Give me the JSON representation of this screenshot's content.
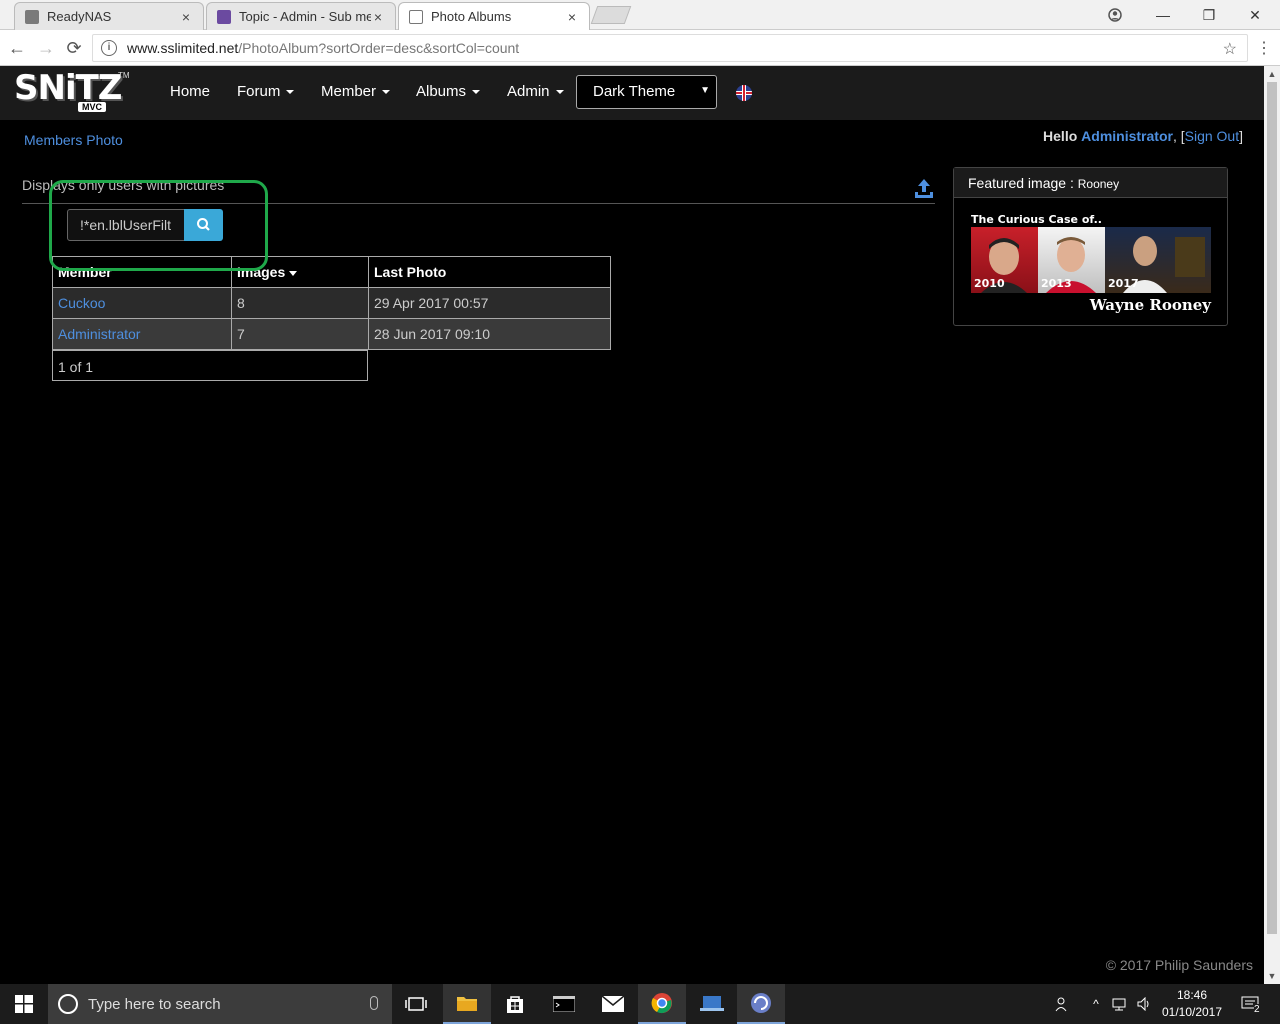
{
  "browser": {
    "tabs": [
      {
        "title": "ReadyNAS",
        "close": "×"
      },
      {
        "title": "Topic - Admin - Sub men",
        "close": "×"
      },
      {
        "title": "Photo Albums",
        "close": "×"
      }
    ],
    "window_controls": {
      "minimize": "—",
      "restore": "❐",
      "close": "✕"
    },
    "url_host": "www.sslimited.net",
    "url_path": "/PhotoAlbum?sortOrder=desc&sortCol=count",
    "back": "←",
    "forward": "→",
    "reload": "⟳",
    "star": "☆",
    "menu": "⋮"
  },
  "navbar": {
    "logo_text": "SNiTZ",
    "logo_sub": "MVC",
    "logo_tm": "TM",
    "items": [
      {
        "label": "Home",
        "dropdown": false
      },
      {
        "label": "Forum",
        "dropdown": true
      },
      {
        "label": "Member",
        "dropdown": true
      },
      {
        "label": "Albums",
        "dropdown": true
      },
      {
        "label": "Admin",
        "dropdown": true
      }
    ],
    "theme_select": "Dark Theme",
    "language_flag": "uk-flag-icon"
  },
  "header": {
    "page_link": "Members Photo",
    "hello": "Hello",
    "user": "Administrator",
    "sign_out": "Sign Out"
  },
  "main": {
    "note": "Displays only users with pictures",
    "search_value": "!*en.lblUserFilt",
    "table": {
      "columns": [
        "Member",
        "Images",
        "Last Photo"
      ],
      "sorted_column": "Images",
      "rows": [
        {
          "member": "Cuckoo",
          "images": "8",
          "last_photo": "29 Apr 2017 00:57"
        },
        {
          "member": "Administrator",
          "images": "7",
          "last_photo": "28 Jun 2017 09:10"
        }
      ],
      "pager": "1 of 1"
    }
  },
  "featured": {
    "label": "Featured image :",
    "caption": "Rooney",
    "image_title": "The Curious Case of..",
    "years": [
      "2010",
      "2013",
      "2017"
    ],
    "image_name": "Wayne Rooney"
  },
  "footer": {
    "copyright": "© 2017 Philip Saunders"
  },
  "taskbar": {
    "search_placeholder": "Type here to search",
    "time": "18:46",
    "date": "01/10/2017",
    "notifications": "2"
  },
  "colors": {
    "link": "#4e8fdf",
    "highlight_box": "#1fa84a",
    "search_button": "#3aa8d8",
    "navbar_bg": "#1b1b1b"
  }
}
